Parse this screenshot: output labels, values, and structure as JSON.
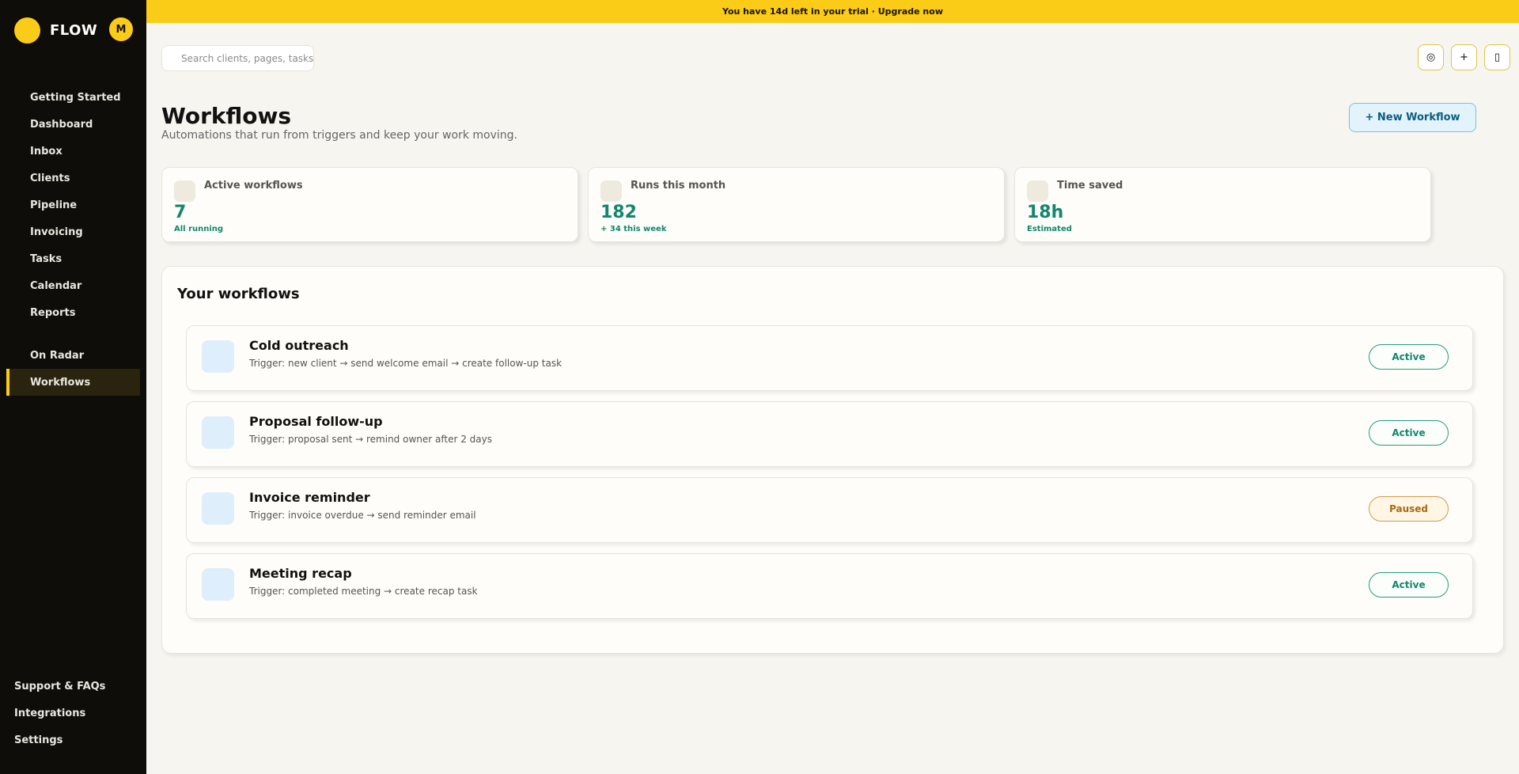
{
  "brand": {
    "name": "FLOW",
    "avatar_initial": "M"
  },
  "banner": {
    "text": "You have 14d left in your trial · Upgrade now"
  },
  "search": {
    "placeholder": "Search clients, pages, tasks"
  },
  "toolbar": {
    "icons": [
      "target-icon",
      "plus-icon",
      "device-icon"
    ],
    "glyphs": [
      "◎",
      "+",
      "▯"
    ]
  },
  "sidebar": {
    "main": [
      "Getting Started",
      "Dashboard",
      "Inbox",
      "Clients",
      "Pipeline",
      "Invoicing",
      "Tasks",
      "Calendar",
      "Reports"
    ],
    "secondary": [
      "On Radar",
      "Workflows"
    ],
    "bottom": [
      "Support & FAQs",
      "Integrations",
      "Settings"
    ],
    "active": "Workflows"
  },
  "header": {
    "title": "Workflows",
    "subtitle": "Automations that run from triggers and keep your work moving.",
    "new_button": "+ New Workflow"
  },
  "stats": [
    {
      "label": "Active workflows",
      "value": "7",
      "note": "All running"
    },
    {
      "label": "Runs this month",
      "value": "182",
      "note": "+ 34 this week"
    },
    {
      "label": "Time saved",
      "value": "18h",
      "note": "Estimated"
    }
  ],
  "workflows_panel": {
    "title": "Your workflows",
    "items": [
      {
        "name": "Cold outreach",
        "trigger": "Trigger: new client → send welcome email → create follow-up task",
        "status": "Active"
      },
      {
        "name": "Proposal follow-up",
        "trigger": "Trigger: proposal sent → remind owner after 2 days",
        "status": "Active"
      },
      {
        "name": "Invoice reminder",
        "trigger": "Trigger: invoice overdue → send reminder email",
        "status": "Paused"
      },
      {
        "name": "Meeting recap",
        "trigger": "Trigger: completed meeting → create recap task",
        "status": "Active"
      }
    ]
  },
  "colors": {
    "accent": "#fbcc17",
    "sidebar_bg": "#0f0d09",
    "success": "#11876d",
    "paused": "#a86a12",
    "info": "#0b5d80"
  }
}
